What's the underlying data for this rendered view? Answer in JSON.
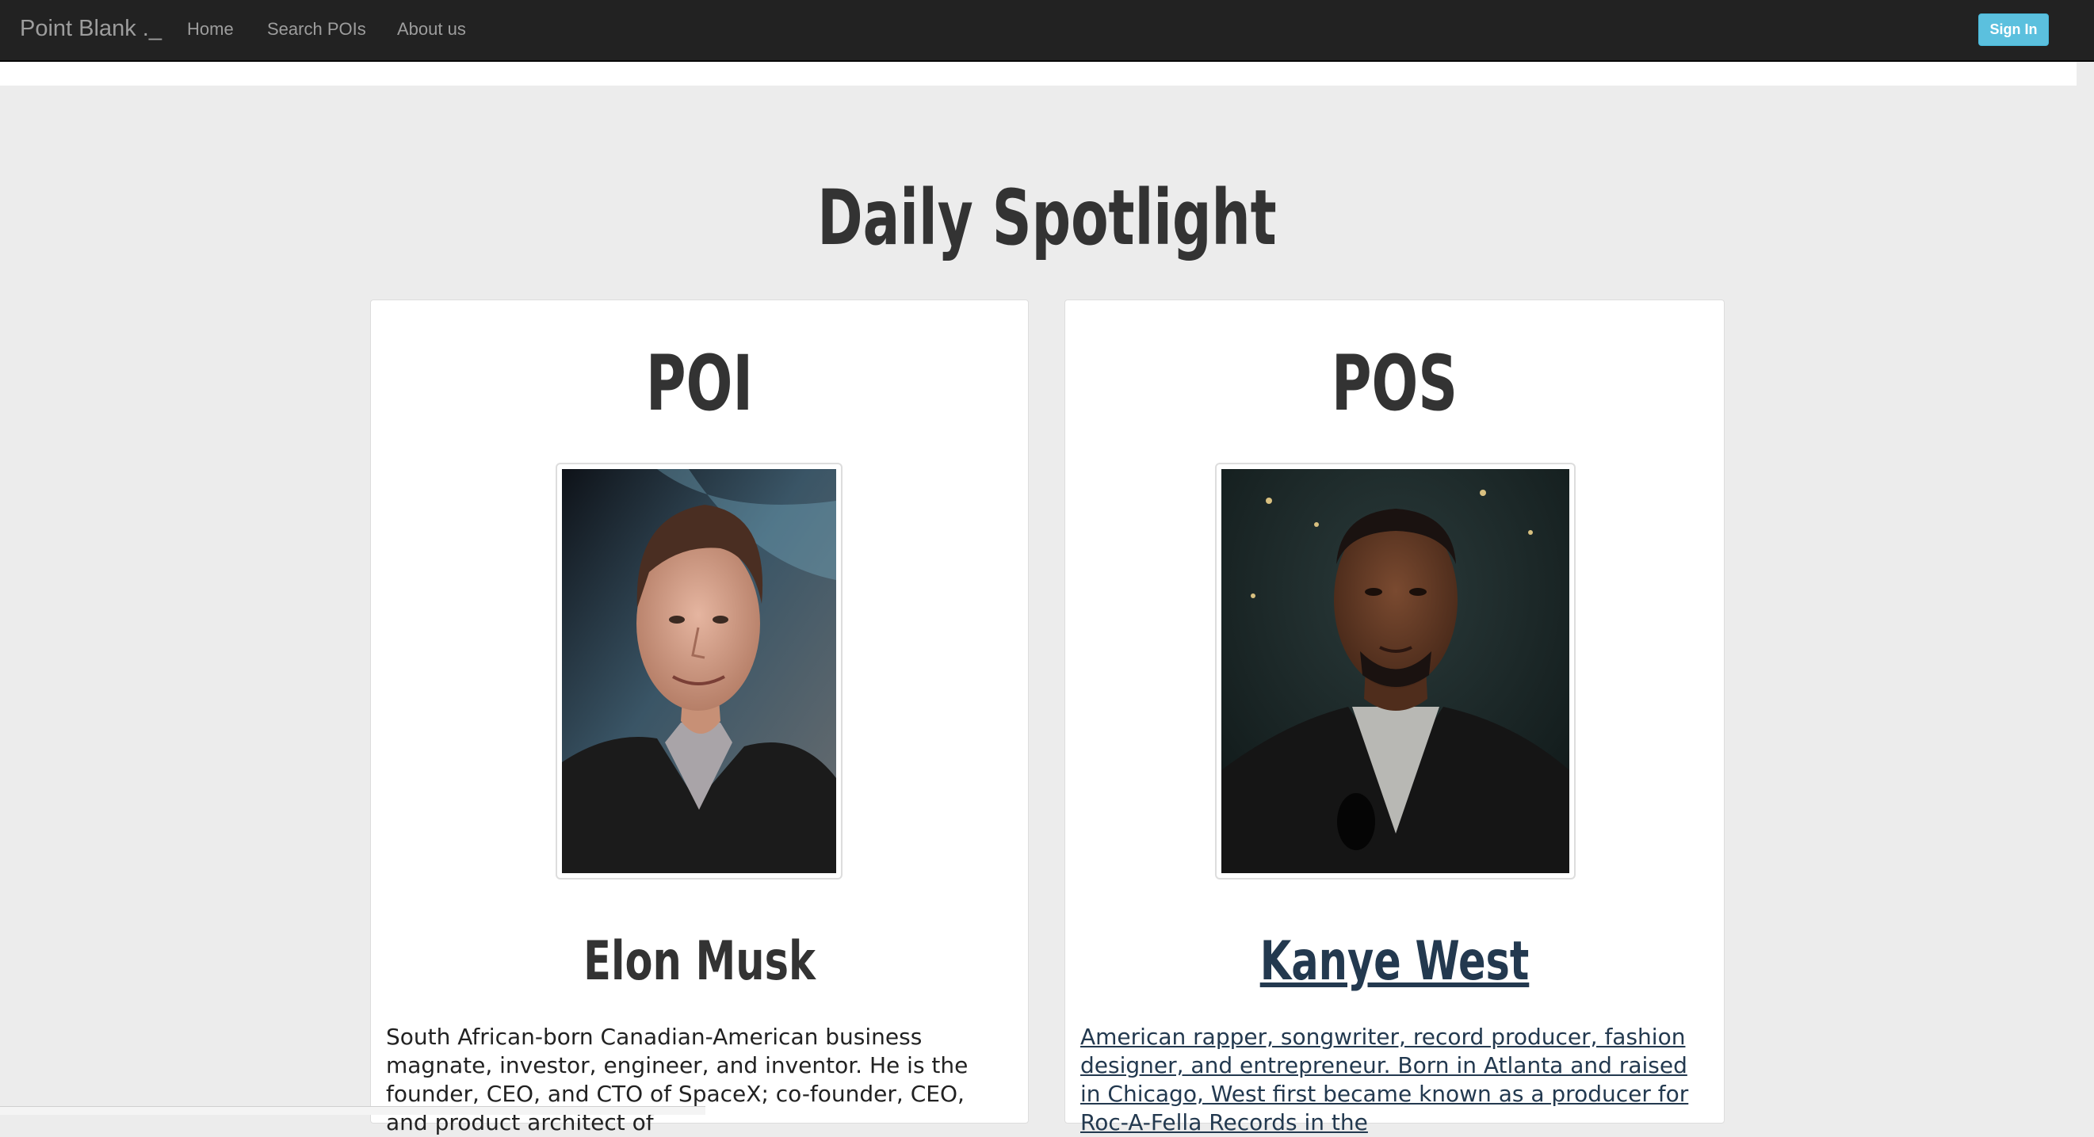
{
  "navbar": {
    "brand": "Point Blank ._",
    "links": [
      "Home",
      "Search POIs",
      "About us"
    ],
    "signin_label": "Sign In"
  },
  "page": {
    "heading": "Daily Spotlight"
  },
  "cards": [
    {
      "title": "POI",
      "name": "Elon Musk",
      "description": "South African-born Canadian-American business magnate, investor, engineer, and inventor. He is the founder, CEO, and CTO of SpaceX; co-founder, CEO, and product architect of"
    },
    {
      "title": "POS",
      "name": "Kanye West",
      "description": "American rapper, songwriter, record producer, fashion designer, and entrepreneur. Born in Atlanta and raised in Chicago, West first became known as a producer for Roc-A-Fella Records in the"
    }
  ],
  "colors": {
    "navbar_bg": "#222222",
    "nav_text": "#9d9d9d",
    "signin_bg": "#5bc0de",
    "page_bg": "#ececec",
    "link": "#23394f"
  }
}
